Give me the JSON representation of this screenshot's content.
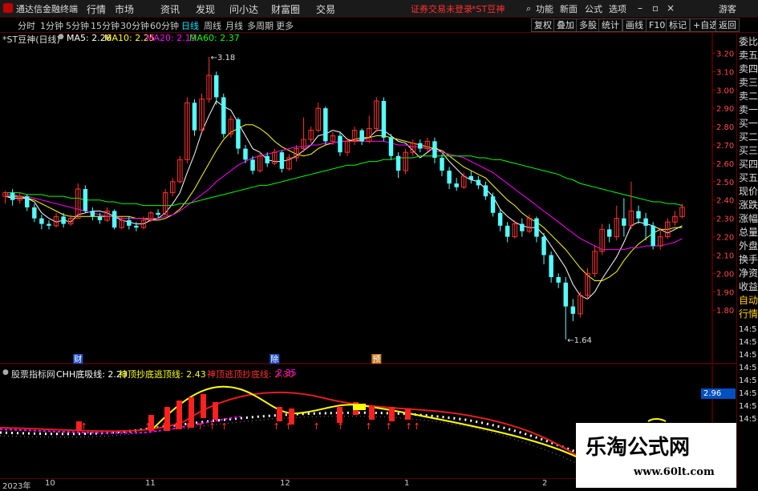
{
  "app": {
    "title": "通达信金融终端"
  },
  "menu": [
    "行情",
    "市场",
    "资讯",
    "发现",
    "问小达",
    "财富圈",
    "交易"
  ],
  "warning": "证券交易未登录",
  "security_label": "*ST豆神",
  "right_menu": [
    "功能",
    "新面",
    "公式",
    "选项"
  ],
  "guest": "游客",
  "periods": [
    "分时",
    "1分钟",
    "5分钟",
    "15分钟",
    "30分钟",
    "60分钟",
    "日线",
    "周线",
    "月线",
    "多周期",
    "更多"
  ],
  "active_period": "日线",
  "tools": [
    "复权",
    "叠加",
    "多股",
    "统计",
    "画线",
    "F10",
    "标记",
    "+自选",
    "返回"
  ],
  "main_info": {
    "name": "*ST豆神(日线)",
    "ma5": "MA5: 2.26",
    "ma10": "MA10: 2.25",
    "ma20": "MA20: 2.19",
    "ma60": "MA60: 2.37"
  },
  "ind_info": {
    "name": "股票指标网",
    "l1": "CHH底吸线: 2.23",
    "l2": "神顶抄底逃顶线: 2.43",
    "l3": "神顶逃顶抄底线: 2.30",
    "l4": "2.35"
  },
  "ind_price_tag": "2.96",
  "high_label": "3.18",
  "low_label": "1.64",
  "markers": [
    "财",
    "除",
    "预"
  ],
  "yaxis": [
    "3.20",
    "3.10",
    "3.00",
    "2.90",
    "2.80",
    "2.70",
    "2.60",
    "2.50",
    "2.40",
    "2.30",
    "2.20",
    "2.10",
    "2.00",
    "1.90",
    "1.80"
  ],
  "side_panel": [
    "委比",
    "卖五",
    "卖四",
    "卖三",
    "卖二",
    "卖一",
    "买一",
    "买二",
    "买三",
    "买四",
    "买五",
    "现价",
    "涨跌",
    "涨幅",
    "总量",
    "外盘",
    "换手",
    "净资",
    "收益",
    "自动",
    "行情"
  ],
  "side_times": [
    "14:5",
    "14:5",
    "14:5",
    "14:5",
    "14:5",
    "14:5",
    "14:5",
    "14:5"
  ],
  "xaxis": [
    "2023年",
    "10",
    "11",
    "12",
    "1",
    "2"
  ],
  "watermark": {
    "title": "乐淘公式网",
    "url": "www.60lt.com"
  },
  "colors": {
    "up": "#ff3232",
    "down": "#54ffff",
    "ma5": "#ffffff",
    "ma10": "#ffff00",
    "ma20": "#ff00ff",
    "ma60": "#00ff00"
  },
  "chart_data": {
    "type": "candlestick",
    "ylim": [
      1.6,
      3.25
    ],
    "candles": [
      [
        2.42,
        2.44,
        2.38,
        2.45
      ],
      [
        2.44,
        2.4,
        2.37,
        2.46
      ],
      [
        2.4,
        2.42,
        2.38,
        2.44
      ],
      [
        2.42,
        2.36,
        2.34,
        2.43
      ],
      [
        2.36,
        2.3,
        2.28,
        2.38
      ],
      [
        2.3,
        2.27,
        2.24,
        2.32
      ],
      [
        2.27,
        2.26,
        2.24,
        2.29
      ],
      [
        2.26,
        2.31,
        2.25,
        2.33
      ],
      [
        2.31,
        2.27,
        2.25,
        2.33
      ],
      [
        2.27,
        2.3,
        2.26,
        2.32
      ],
      [
        2.3,
        2.46,
        2.3,
        2.49
      ],
      [
        2.46,
        2.34,
        2.33,
        2.48
      ],
      [
        2.34,
        2.31,
        2.29,
        2.36
      ],
      [
        2.31,
        2.29,
        2.27,
        2.33
      ],
      [
        2.29,
        2.34,
        2.28,
        2.36
      ],
      [
        2.34,
        2.25,
        2.24,
        2.35
      ],
      [
        2.25,
        2.29,
        2.24,
        2.31
      ],
      [
        2.29,
        2.26,
        2.24,
        2.31
      ],
      [
        2.26,
        2.25,
        2.23,
        2.28
      ],
      [
        2.25,
        2.29,
        2.24,
        2.31
      ],
      [
        2.29,
        2.33,
        2.28,
        2.34
      ],
      [
        2.33,
        2.32,
        2.3,
        2.35
      ],
      [
        2.32,
        2.44,
        2.32,
        2.46
      ],
      [
        2.44,
        2.5,
        2.42,
        2.52
      ],
      [
        2.5,
        2.62,
        2.49,
        2.64
      ],
      [
        2.62,
        2.93,
        2.6,
        2.96
      ],
      [
        2.93,
        2.78,
        2.75,
        2.95
      ],
      [
        2.78,
        2.95,
        2.77,
        2.98
      ],
      [
        2.95,
        3.08,
        2.93,
        3.18
      ],
      [
        3.08,
        2.96,
        2.92,
        3.1
      ],
      [
        2.96,
        2.76,
        2.74,
        2.98
      ],
      [
        2.76,
        2.84,
        2.74,
        2.86
      ],
      [
        2.84,
        2.68,
        2.65,
        2.85
      ],
      [
        2.68,
        2.62,
        2.6,
        2.7
      ],
      [
        2.62,
        2.56,
        2.54,
        2.64
      ],
      [
        2.56,
        2.64,
        2.55,
        2.66
      ],
      [
        2.64,
        2.6,
        2.58,
        2.66
      ],
      [
        2.6,
        2.66,
        2.59,
        2.68
      ],
      [
        2.66,
        2.57,
        2.55,
        2.67
      ],
      [
        2.57,
        2.63,
        2.56,
        2.65
      ],
      [
        2.63,
        2.68,
        2.61,
        2.7
      ],
      [
        2.68,
        2.73,
        2.66,
        2.85
      ],
      [
        2.73,
        2.78,
        2.71,
        2.8
      ],
      [
        2.78,
        2.9,
        2.77,
        2.93
      ],
      [
        2.9,
        2.72,
        2.7,
        2.91
      ],
      [
        2.72,
        2.75,
        2.7,
        2.77
      ],
      [
        2.75,
        2.66,
        2.64,
        2.77
      ],
      [
        2.66,
        2.72,
        2.64,
        2.74
      ],
      [
        2.72,
        2.78,
        2.7,
        2.8
      ],
      [
        2.78,
        2.72,
        2.7,
        2.79
      ],
      [
        2.72,
        2.79,
        2.71,
        2.86
      ],
      [
        2.79,
        2.94,
        2.77,
        2.96
      ],
      [
        2.94,
        2.74,
        2.72,
        2.96
      ],
      [
        2.74,
        2.64,
        2.62,
        2.76
      ],
      [
        2.64,
        2.56,
        2.52,
        2.66
      ],
      [
        2.56,
        2.66,
        2.54,
        2.68
      ],
      [
        2.66,
        2.71,
        2.64,
        2.73
      ],
      [
        2.71,
        2.68,
        2.66,
        2.73
      ],
      [
        2.68,
        2.72,
        2.66,
        2.74
      ],
      [
        2.72,
        2.63,
        2.6,
        2.74
      ],
      [
        2.63,
        2.56,
        2.53,
        2.65
      ],
      [
        2.56,
        2.49,
        2.46,
        2.58
      ],
      [
        2.49,
        2.47,
        2.45,
        2.52
      ],
      [
        2.47,
        2.53,
        2.46,
        2.55
      ],
      [
        2.53,
        2.51,
        2.49,
        2.56
      ],
      [
        2.51,
        2.48,
        2.46,
        2.53
      ],
      [
        2.48,
        2.42,
        2.4,
        2.5
      ],
      [
        2.42,
        2.33,
        2.31,
        2.44
      ],
      [
        2.33,
        2.26,
        2.23,
        2.35
      ],
      [
        2.26,
        2.2,
        2.17,
        2.28
      ],
      [
        2.2,
        2.27,
        2.19,
        2.29
      ],
      [
        2.27,
        2.23,
        2.2,
        2.3
      ],
      [
        2.23,
        2.3,
        2.22,
        2.32
      ],
      [
        2.3,
        2.2,
        2.17,
        2.31
      ],
      [
        2.2,
        2.1,
        2.05,
        2.22
      ],
      [
        2.1,
        1.98,
        1.95,
        2.12
      ],
      [
        1.98,
        1.95,
        1.92,
        2.0
      ],
      [
        1.95,
        1.82,
        1.64,
        1.98
      ],
      [
        1.82,
        1.78,
        1.74,
        1.86
      ],
      [
        1.78,
        1.88,
        1.76,
        1.9
      ],
      [
        1.88,
        2.0,
        1.86,
        2.03
      ],
      [
        2.0,
        2.12,
        1.98,
        2.15
      ],
      [
        2.12,
        2.24,
        2.1,
        2.27
      ],
      [
        2.24,
        2.2,
        2.17,
        2.27
      ],
      [
        2.2,
        2.3,
        2.18,
        2.37
      ],
      [
        2.3,
        2.26,
        2.2,
        2.41
      ],
      [
        2.26,
        2.34,
        2.24,
        2.5
      ],
      [
        2.34,
        2.3,
        2.27,
        2.37
      ],
      [
        2.3,
        2.26,
        2.18,
        2.33
      ],
      [
        2.26,
        2.15,
        2.13,
        2.28
      ],
      [
        2.15,
        2.2,
        2.13,
        2.25
      ],
      [
        2.2,
        2.28,
        2.19,
        2.3
      ],
      [
        2.28,
        2.31,
        2.26,
        2.34
      ],
      [
        2.31,
        2.36,
        2.3,
        2.38
      ]
    ],
    "ma_series": [
      {
        "name": "MA5",
        "values": [
          2.42,
          2.41,
          2.41,
          2.41,
          2.39,
          2.33,
          2.3,
          2.28,
          2.29,
          2.28,
          2.32,
          2.33,
          2.34,
          2.34,
          2.33,
          2.31,
          2.29,
          2.28,
          2.27,
          2.27,
          2.29,
          2.3,
          2.33,
          2.38,
          2.44,
          2.55,
          2.65,
          2.77,
          2.86,
          2.94,
          2.91,
          2.89,
          2.82,
          2.75,
          2.68,
          2.66,
          2.62,
          2.61,
          2.61,
          2.62,
          2.64,
          2.67,
          2.7,
          2.75,
          2.76,
          2.78,
          2.77,
          2.73,
          2.72,
          2.73,
          2.74,
          2.78,
          2.78,
          2.75,
          2.72,
          2.71,
          2.67,
          2.63,
          2.66,
          2.69,
          2.66,
          2.61,
          2.57,
          2.53,
          2.51,
          2.5,
          2.46,
          2.42,
          2.35,
          2.31,
          2.28,
          2.26,
          2.25,
          2.25,
          2.21,
          2.15,
          2.09,
          2.03,
          1.94,
          1.88,
          1.86,
          1.9,
          1.97,
          2.03,
          2.09,
          2.17,
          2.26,
          2.28,
          2.27,
          2.26,
          2.24,
          2.22,
          2.24,
          2.26
        ]
      },
      {
        "name": "MA10",
        "values": [
          2.42,
          2.42,
          2.42,
          2.41,
          2.4,
          2.38,
          2.36,
          2.34,
          2.32,
          2.31,
          2.31,
          2.31,
          2.31,
          2.31,
          2.31,
          2.31,
          2.31,
          2.31,
          2.3,
          2.3,
          2.29,
          2.29,
          2.3,
          2.32,
          2.35,
          2.4,
          2.46,
          2.53,
          2.6,
          2.67,
          2.73,
          2.77,
          2.79,
          2.81,
          2.81,
          2.79,
          2.76,
          2.72,
          2.69,
          2.67,
          2.65,
          2.64,
          2.65,
          2.68,
          2.7,
          2.71,
          2.72,
          2.72,
          2.73,
          2.74,
          2.74,
          2.75,
          2.75,
          2.74,
          2.73,
          2.72,
          2.71,
          2.7,
          2.69,
          2.68,
          2.67,
          2.64,
          2.61,
          2.58,
          2.56,
          2.54,
          2.52,
          2.48,
          2.44,
          2.4,
          2.37,
          2.33,
          2.3,
          2.28,
          2.25,
          2.21,
          2.17,
          2.13,
          2.08,
          2.03,
          1.99,
          1.96,
          1.96,
          1.98,
          2.01,
          2.07,
          2.12,
          2.16,
          2.19,
          2.22,
          2.24,
          2.24,
          2.25,
          2.25
        ]
      },
      {
        "name": "MA20",
        "values": [
          2.43,
          2.43,
          2.42,
          2.42,
          2.41,
          2.4,
          2.39,
          2.38,
          2.37,
          2.36,
          2.35,
          2.34,
          2.33,
          2.32,
          2.31,
          2.31,
          2.3,
          2.3,
          2.3,
          2.3,
          2.3,
          2.3,
          2.31,
          2.32,
          2.34,
          2.37,
          2.4,
          2.43,
          2.46,
          2.5,
          2.53,
          2.56,
          2.59,
          2.61,
          2.63,
          2.64,
          2.65,
          2.66,
          2.67,
          2.68,
          2.69,
          2.69,
          2.7,
          2.7,
          2.71,
          2.71,
          2.72,
          2.72,
          2.72,
          2.72,
          2.72,
          2.72,
          2.72,
          2.71,
          2.7,
          2.7,
          2.69,
          2.69,
          2.68,
          2.67,
          2.66,
          2.65,
          2.64,
          2.63,
          2.61,
          2.59,
          2.57,
          2.55,
          2.52,
          2.49,
          2.46,
          2.43,
          2.4,
          2.37,
          2.34,
          2.31,
          2.28,
          2.25,
          2.22,
          2.19,
          2.17,
          2.15,
          2.13,
          2.13,
          2.13,
          2.13,
          2.14,
          2.14,
          2.15,
          2.15,
          2.15,
          2.16,
          2.17,
          2.19
        ]
      },
      {
        "name": "MA60",
        "values": [
          2.44,
          2.44,
          2.44,
          2.43,
          2.43,
          2.43,
          2.42,
          2.42,
          2.42,
          2.41,
          2.41,
          2.4,
          2.4,
          2.4,
          2.39,
          2.39,
          2.38,
          2.38,
          2.38,
          2.37,
          2.37,
          2.37,
          2.37,
          2.37,
          2.38,
          2.38,
          2.39,
          2.4,
          2.41,
          2.42,
          2.43,
          2.44,
          2.45,
          2.46,
          2.47,
          2.48,
          2.48,
          2.49,
          2.5,
          2.51,
          2.52,
          2.53,
          2.54,
          2.55,
          2.56,
          2.57,
          2.58,
          2.59,
          2.59,
          2.6,
          2.61,
          2.61,
          2.62,
          2.62,
          2.63,
          2.63,
          2.63,
          2.64,
          2.64,
          2.64,
          2.64,
          2.64,
          2.64,
          2.64,
          2.64,
          2.63,
          2.63,
          2.62,
          2.62,
          2.61,
          2.6,
          2.59,
          2.58,
          2.57,
          2.56,
          2.55,
          2.54,
          2.52,
          2.51,
          2.49,
          2.48,
          2.47,
          2.46,
          2.45,
          2.44,
          2.43,
          2.42,
          2.41,
          2.4,
          2.39,
          2.39,
          2.38,
          2.38,
          2.37
        ]
      }
    ]
  }
}
